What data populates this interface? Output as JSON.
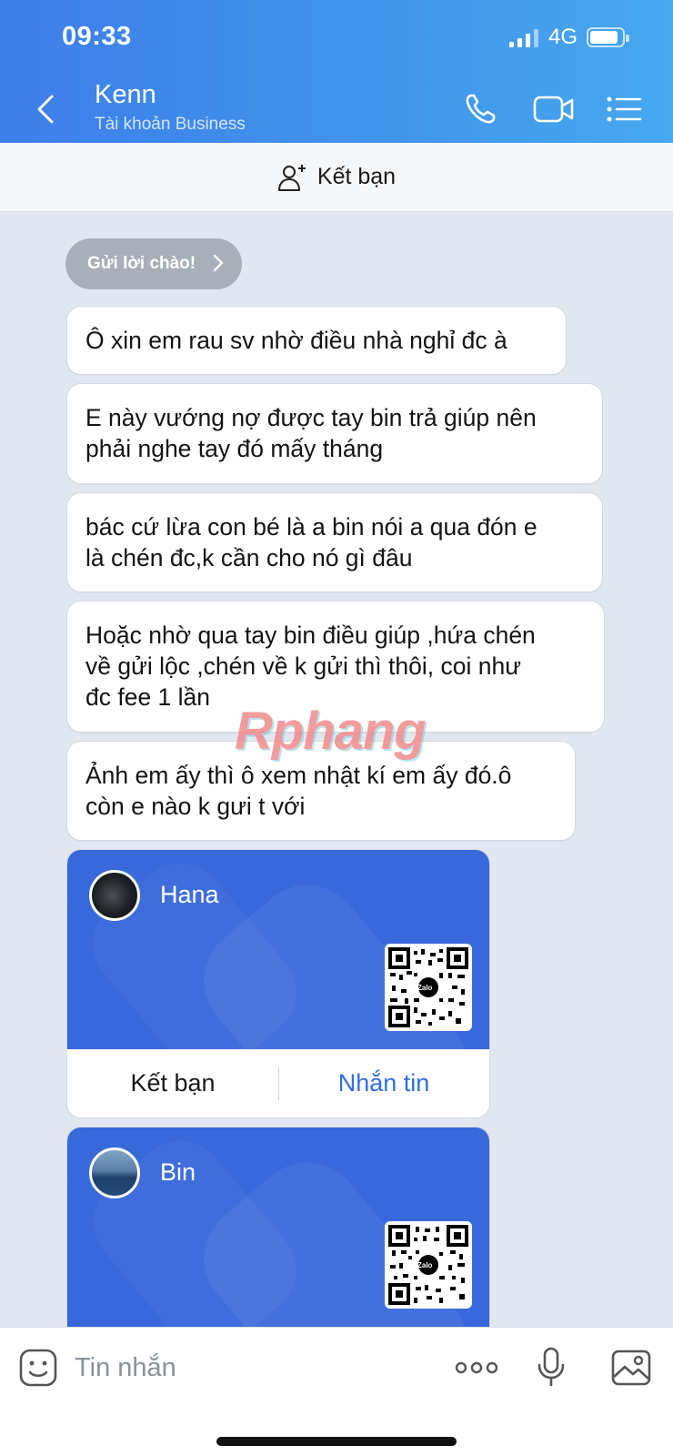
{
  "status_bar": {
    "time": "09:33",
    "network": "4G"
  },
  "header": {
    "name": "Kenn",
    "subtitle": "Tài khoản Business"
  },
  "add_friend_bar": {
    "label": "Kết bạn"
  },
  "greeting": {
    "label": "Gửi lời chào!"
  },
  "messages": [
    {
      "text": "Ô xin em rau sv nhờ điều nhà nghỉ đc à"
    },
    {
      "text": "E này vướng nợ được tay bin  trả giúp nên\nphải nghe tay đó mấy tháng"
    },
    {
      "text": "bác cứ lừa con bé là a bin nói a qua đón e\nlà chén đc,k cần cho nó gì đâu"
    },
    {
      "text": "Hoặc nhờ qua tay bin điều giúp ,hứa chén\nvề gửi lộc ,chén về k gửi thì thôi, coi như\nđc fee 1 lần"
    },
    {
      "text": "Ảnh em ấy thì ô xem nhật kí em ấy đó.ô\ncòn e nào k gưi t với"
    }
  ],
  "watermark": "Rphang",
  "cards": [
    {
      "name": "Hana",
      "qr_label": "Zalo",
      "add_label": "Kết bạn",
      "message_label": "Nhắn tin"
    },
    {
      "name": "Bin",
      "qr_label": "Zalo"
    }
  ],
  "input": {
    "placeholder": "Tin nhắn"
  },
  "colors": {
    "header_blue": "#3d7ee9",
    "card_blue": "#3868da",
    "link_blue": "#2f6fe0"
  }
}
